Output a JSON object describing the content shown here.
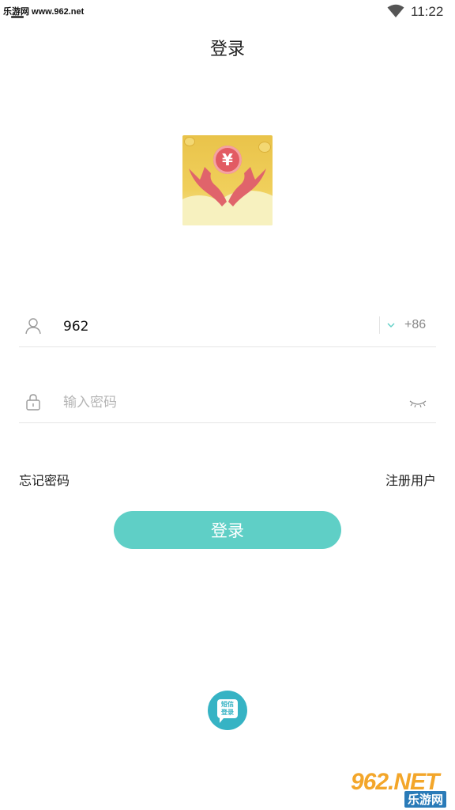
{
  "status_bar": {
    "watermark": "乐游网 www.962.net",
    "time": "11:22",
    "wifi_icon": "wifi-icon"
  },
  "header": {
    "title": "登录"
  },
  "logo": {
    "symbol": "¥",
    "description_icon": "money-hands-logo"
  },
  "form": {
    "account": {
      "icon": "user-icon",
      "value": "962",
      "country_code": "+86",
      "dropdown_icon": "chevron-down-icon"
    },
    "password": {
      "icon": "lock-icon",
      "placeholder": "输入密码",
      "toggle_icon": "eye-closed-icon"
    }
  },
  "links": {
    "forgot_password": "忘记密码",
    "register": "注册用户"
  },
  "login_button": "登录",
  "sms_login": {
    "line1": "短信",
    "line2": "登录"
  },
  "footer_watermark": {
    "brand": "962.NET",
    "site": "乐游网"
  },
  "colors": {
    "accent": "#5fcfc6",
    "sms": "#36b3c4"
  }
}
